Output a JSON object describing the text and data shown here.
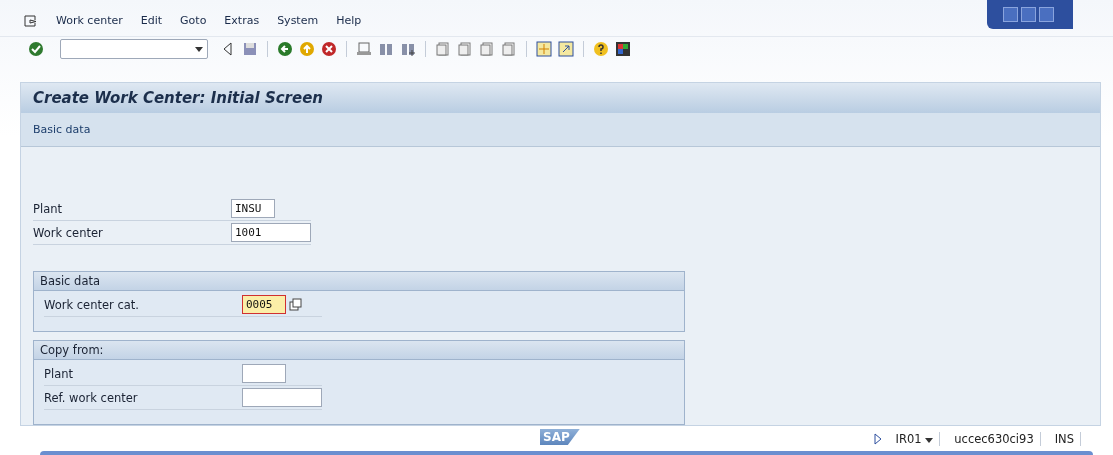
{
  "menu": [
    "Work center",
    "Edit",
    "Goto",
    "Extras",
    "System",
    "Help"
  ],
  "title": "Create Work Center: Initial Screen",
  "app_toolbar": [
    "Basic data"
  ],
  "fields": [
    {
      "label": "Plant",
      "value": "INSU",
      "kind": "short",
      "focused": false,
      "f4": false
    },
    {
      "label": "Work center",
      "value": "1001",
      "kind": "long",
      "focused": false,
      "f4": false
    }
  ],
  "groups": [
    {
      "title": "Basic data",
      "fields": [
        {
          "label": "Work center cat.",
          "value": "0005",
          "kind": "short",
          "focused": true,
          "f4": true
        }
      ]
    },
    {
      "title": "Copy from:",
      "fields": [
        {
          "label": "Plant",
          "kind": "short",
          "focused": false,
          "f4": false
        },
        {
          "label": "Ref. work center",
          "kind": "long",
          "focused": false,
          "f4": false
        }
      ]
    }
  ],
  "status_bar": {
    "logo": "SAP",
    "system": "IR01",
    "server": "uccec630ci93",
    "mode": "INS"
  }
}
